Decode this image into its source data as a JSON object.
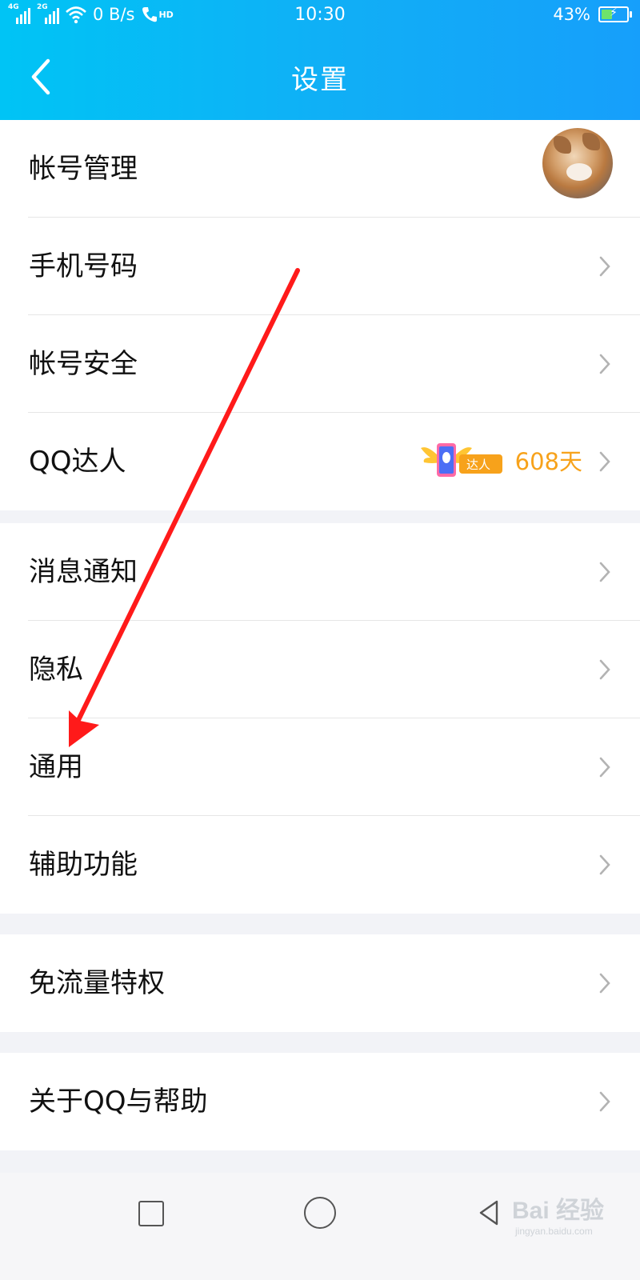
{
  "status_bar": {
    "network1": "4G",
    "network2": "2G",
    "speed": "0 B/s",
    "hd": "HD",
    "time": "10:30",
    "battery_percent": "43%",
    "battery_level": 0.43
  },
  "header": {
    "title": "设置",
    "back_icon": "chevron-left-icon"
  },
  "groups": [
    {
      "rows": [
        {
          "label": "帐号管理",
          "trailing": "avatar"
        },
        {
          "label": "手机号码"
        },
        {
          "label": "帐号安全"
        },
        {
          "label": "QQ达人",
          "badge_text": "达人",
          "days": "608天"
        }
      ]
    },
    {
      "rows": [
        {
          "label": "消息通知"
        },
        {
          "label": "隐私"
        },
        {
          "label": "通用"
        },
        {
          "label": "辅助功能"
        }
      ]
    },
    {
      "rows": [
        {
          "label": "免流量特权"
        }
      ]
    },
    {
      "rows": [
        {
          "label": "关于QQ与帮助"
        }
      ]
    }
  ],
  "annotation": {
    "type": "red-arrow",
    "color": "#ff1a1a",
    "points_to": "通用"
  },
  "watermark": {
    "main": "Bai 经验",
    "sub": "jingyan.baidu.com"
  },
  "colors": {
    "header_start": "#00c4f5",
    "header_end": "#169ffb",
    "badge_orange": "#f7a21b",
    "background": "#f2f3f7"
  }
}
